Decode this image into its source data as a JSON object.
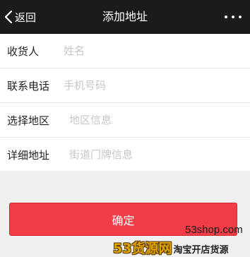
{
  "header": {
    "back_label": "返回",
    "title": "添加地址"
  },
  "form": {
    "fields": [
      {
        "label": "收货人",
        "placeholder": "姓名",
        "value": ""
      },
      {
        "label": "联系电话",
        "placeholder": "手机号码",
        "value": ""
      },
      {
        "label": "选择地区",
        "placeholder": "地区信息",
        "value": ""
      },
      {
        "label": "详细地址",
        "placeholder": "街道门牌信息",
        "value": ""
      }
    ]
  },
  "actions": {
    "confirm_label": "确定"
  },
  "watermark": {
    "site": "53shop.com",
    "brand": "53货源网",
    "slogan": "淘宝开店货源"
  },
  "colors": {
    "nav_bg": "#1b1b1b",
    "accent": "#f23c46",
    "page_bg": "#f0f0f0"
  },
  "icons": {
    "back": "chevron-left-icon",
    "more": "more-dots-icon"
  }
}
